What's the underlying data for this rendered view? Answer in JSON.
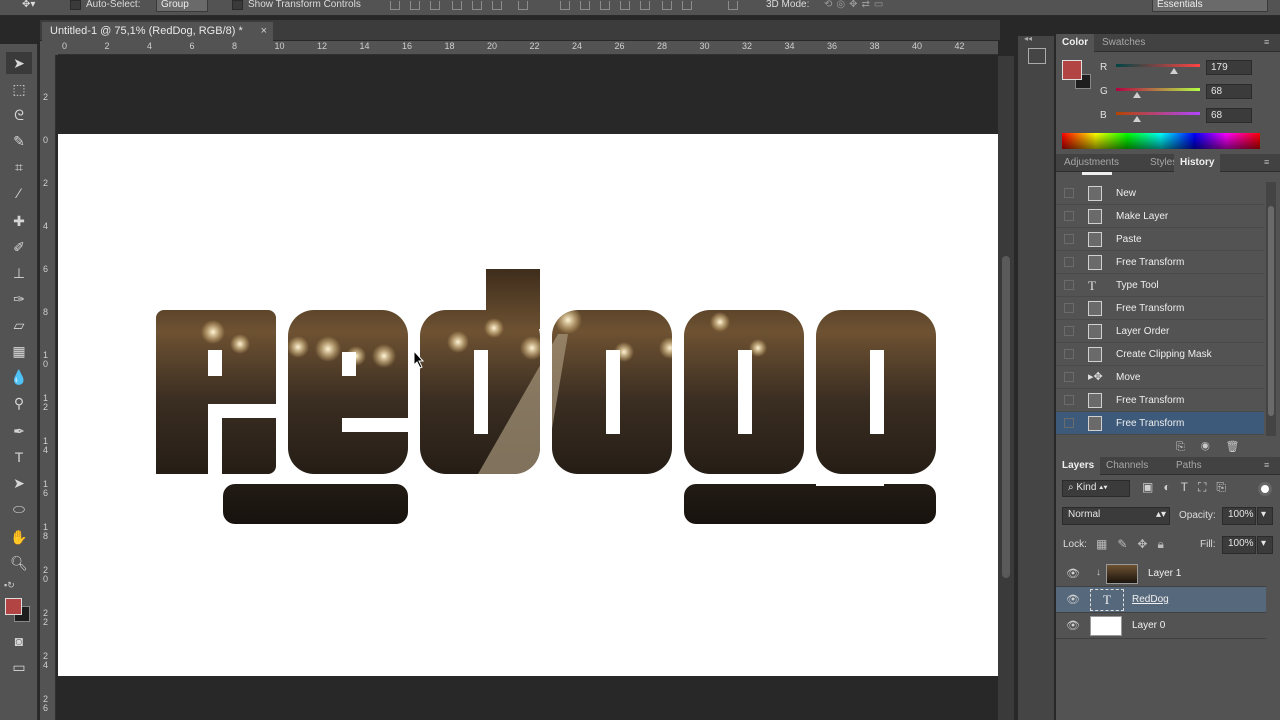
{
  "options_bar": {
    "auto_select_label": "Auto-Select:",
    "auto_select_value": "Group",
    "show_transform_label": "Show Transform Controls",
    "mode_3d_label": "3D Mode:",
    "workspace_value": "Essentials"
  },
  "document_tab": {
    "title": "Untitled-1 @ 75,1% (RedDog, RGB/8) *",
    "close": "×"
  },
  "rulers": {
    "horizontal": [
      "0",
      "2",
      "4",
      "6",
      "8",
      "10",
      "12",
      "14",
      "16",
      "18",
      "20",
      "22",
      "24",
      "26",
      "28",
      "30",
      "32",
      "34",
      "36",
      "38",
      "40",
      "42"
    ],
    "vertical": [
      "2",
      "0",
      "2",
      "4",
      "6",
      "8",
      "1\n0",
      "1\n2",
      "1\n4",
      "1\n6",
      "1\n8",
      "2\n0",
      "2\n2",
      "2\n4",
      "2\n6"
    ]
  },
  "canvas": {
    "text": "RedDog"
  },
  "color_panel": {
    "tabs": [
      "Color",
      "Swatches"
    ],
    "active_tab": "Color",
    "foreground": "#b34444",
    "background": "#1e1e1e",
    "channels": [
      {
        "label": "R",
        "value": "179",
        "fraction": 0.702
      },
      {
        "label": "G",
        "value": "68",
        "fraction": 0.267
      },
      {
        "label": "B",
        "value": "68",
        "fraction": 0.267
      }
    ]
  },
  "history_panel": {
    "tabs": [
      "Adjustments",
      "Styles",
      "History"
    ],
    "active_tab": "History",
    "items": [
      {
        "label": "New",
        "icon": "document-icon"
      },
      {
        "label": "Make Layer",
        "icon": "document-icon"
      },
      {
        "label": "Paste",
        "icon": "document-icon"
      },
      {
        "label": "Free Transform",
        "icon": "document-icon"
      },
      {
        "label": "Type Tool",
        "icon": "type-icon"
      },
      {
        "label": "Free Transform",
        "icon": "document-icon"
      },
      {
        "label": "Layer Order",
        "icon": "document-icon"
      },
      {
        "label": "Create Clipping Mask",
        "icon": "document-icon"
      },
      {
        "label": "Move",
        "icon": "move-icon"
      },
      {
        "label": "Free Transform",
        "icon": "document-icon"
      },
      {
        "label": "Free Transform",
        "icon": "document-icon",
        "selected": true
      }
    ]
  },
  "layers_panel": {
    "tabs": [
      "Layers",
      "Channels",
      "Paths"
    ],
    "active_tab": "Layers",
    "filter_kind": "Kind",
    "blend_mode": "Normal",
    "opacity_label": "Opacity:",
    "opacity_value": "100%",
    "lock_label": "Lock:",
    "fill_label": "Fill:",
    "fill_value": "100%",
    "layers": [
      {
        "name": "Layer 1",
        "type": "image",
        "clipped": true
      },
      {
        "name": "RedDog",
        "type": "text",
        "selected": true
      },
      {
        "name": "Layer 0",
        "type": "white"
      }
    ]
  }
}
